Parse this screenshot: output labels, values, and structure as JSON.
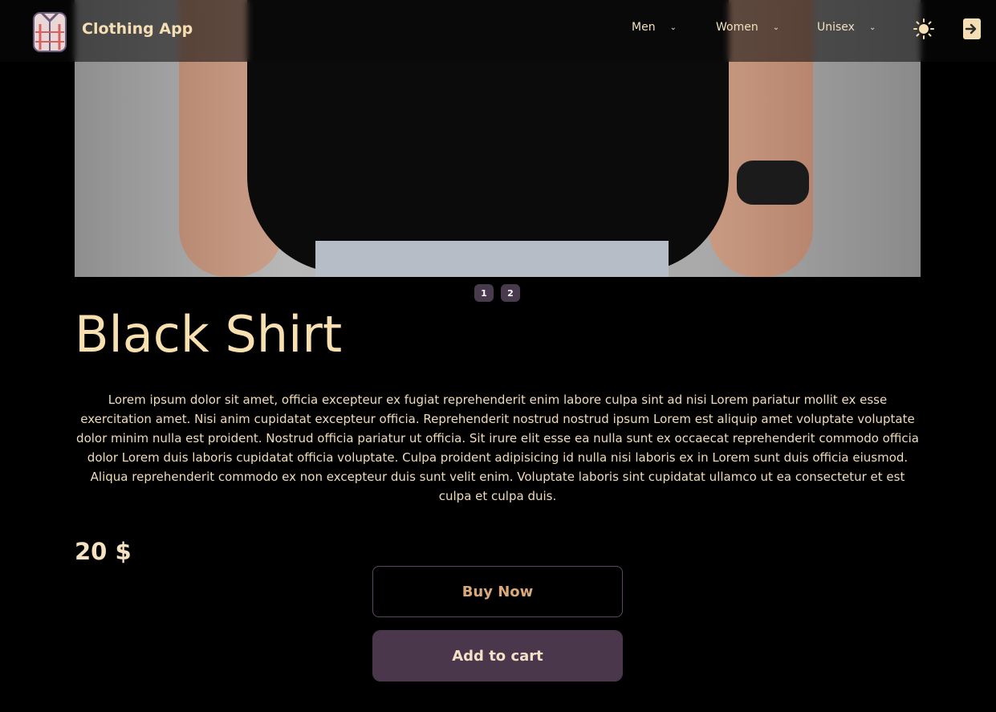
{
  "nav": {
    "brand": "Clothing App",
    "menu": [
      {
        "label": "Men"
      },
      {
        "label": "Women"
      },
      {
        "label": "Unisex"
      }
    ]
  },
  "gallery": {
    "pages": [
      "1",
      "2"
    ]
  },
  "product": {
    "name": "Black Shirt",
    "description": "Lorem ipsum dolor sit amet, officia excepteur ex fugiat reprehenderit enim labore culpa sint ad nisi Lorem pariatur mollit ex esse exercitation amet. Nisi anim cupidatat excepteur officia. Reprehenderit nostrud nostrud ipsum Lorem est aliquip amet voluptate voluptate dolor minim nulla est proident. Nostrud officia pariatur ut officia. Sit irure elit esse ea nulla sunt ex occaecat reprehenderit commodo officia dolor Lorem duis laboris cupidatat officia voluptate. Culpa proident adipisicing id nulla nisi laboris ex in Lorem sunt duis officia eiusmod. Aliqua reprehenderit commodo ex non excepteur duis sunt velit enim. Voluptate laboris sint cupidatat ullamco ut ea consectetur et est culpa et culpa duis.",
    "price": "20 $"
  },
  "actions": {
    "buy_label": "Buy Now",
    "cart_label": "Add to cart"
  },
  "icons": {
    "logo": "shirt-logo-icon",
    "theme": "sun-icon",
    "login": "login-icon",
    "chevron": "chevron-down-icon"
  },
  "colors": {
    "accent": "#f5deb3",
    "button_bg": "#4a374c",
    "background": "#000000"
  }
}
